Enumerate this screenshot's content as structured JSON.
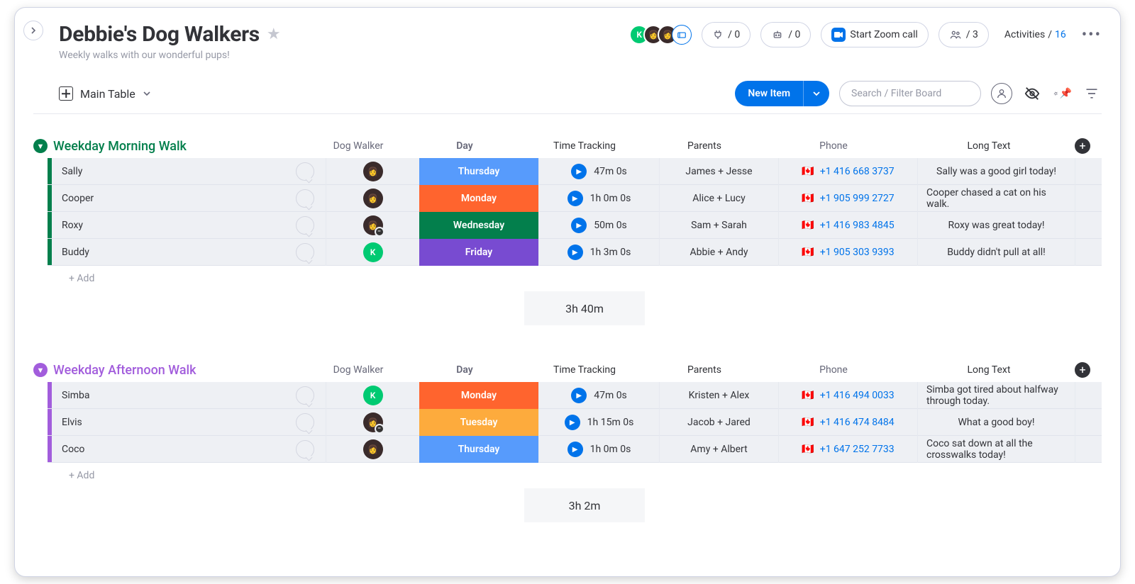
{
  "header": {
    "title": "Debbie's Dog Walkers",
    "subtitle": "Weekly walks with our wonderful pups!",
    "integrations_count": "0",
    "automations_count": "0",
    "zoom_label": "Start Zoom call",
    "members_count": "3",
    "activities_label": "Activities",
    "activities_count": "16"
  },
  "toolbar": {
    "view_label": "Main Table",
    "new_item_label": "New Item",
    "search_placeholder": "Search / Filter Board"
  },
  "columns": {
    "walker": "Dog Walker",
    "day": "Day",
    "time": "Time Tracking",
    "parents": "Parents",
    "phone": "Phone",
    "note": "Long Text"
  },
  "add_row_label": "+ Add",
  "groups": [
    {
      "title": "Weekday Morning Walk",
      "color": "#037f4c",
      "total_time": "3h 40m",
      "rows": [
        {
          "name": "Sally",
          "walker": "img",
          "walker_badge": "",
          "day": "Thursday",
          "day_color": "#579bfc",
          "time": "47m 0s",
          "parents": "James + Jesse",
          "phone": "+1 416 668 3737",
          "note": "Sally was a good girl today!"
        },
        {
          "name": "Cooper",
          "walker": "img",
          "walker_badge": "",
          "day": "Monday",
          "day_color": "#ff642e",
          "time": "1h 0m 0s",
          "parents": "Alice + Lucy",
          "phone": "+1 905 999 2727",
          "note": "Cooper chased a cat on his walk."
        },
        {
          "name": "Roxy",
          "walker": "img",
          "walker_badge": "−",
          "day": "Wednesday",
          "day_color": "#037f4c",
          "time": "50m 0s",
          "parents": "Sam + Sarah",
          "phone": "+1 416 983 4845",
          "note": "Roxy was great today!"
        },
        {
          "name": "Buddy",
          "walker": "K",
          "walker_badge": "",
          "day": "Friday",
          "day_color": "#784bd1",
          "time": "1h 3m 0s",
          "parents": "Abbie + Andy",
          "phone": "+1 905 303 9393",
          "note": "Buddy didn't pull at all!"
        }
      ]
    },
    {
      "title": "Weekday Afternoon Walk",
      "color": "#a25ddc",
      "total_time": "3h 2m",
      "rows": [
        {
          "name": "Simba",
          "walker": "K",
          "walker_badge": "",
          "day": "Monday",
          "day_color": "#ff642e",
          "time": "47m 0s",
          "parents": "Kristen + Alex",
          "phone": "+1 416 494 0033",
          "note": "Simba got tired about halfway through today."
        },
        {
          "name": "Elvis",
          "walker": "img",
          "walker_badge": "−",
          "day": "Tuesday",
          "day_color": "#fdab3d",
          "time": "1h 15m 0s",
          "parents": "Jacob + Jared",
          "phone": "+1 416 474 8484",
          "note": "What a good boy!"
        },
        {
          "name": "Coco",
          "walker": "img",
          "walker_badge": "",
          "day": "Thursday",
          "day_color": "#579bfc",
          "time": "1h 0m 0s",
          "parents": "Amy + Albert",
          "phone": "+1 647 252 7733",
          "note": "Coco sat down at all the crosswalks today!"
        }
      ]
    }
  ]
}
